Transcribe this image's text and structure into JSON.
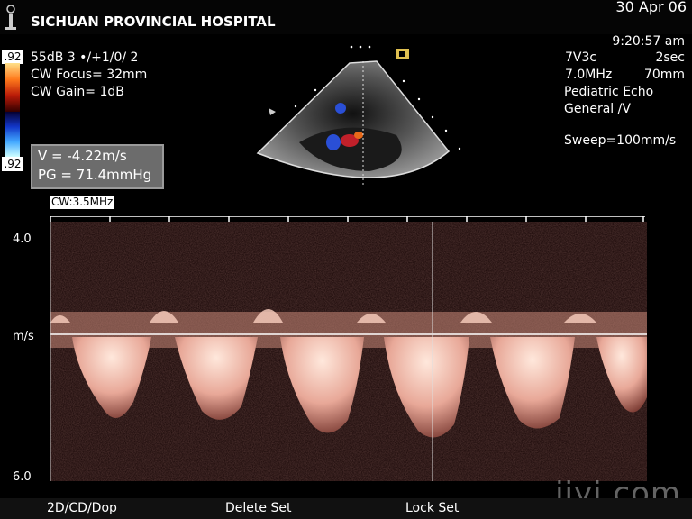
{
  "header": {
    "hospital": "SICHUAN PROVINCIAL HOSPITAL",
    "date": "30 Apr 06"
  },
  "settings_left": {
    "scale_top": ".92",
    "line1": "55dB  3 •/+1/0/ 2",
    "line2": "CW Focus=  32mm",
    "line3": "CW Gain=    1dB",
    "scale_bottom": ".92"
  },
  "measurement": {
    "velocity": "V = -4.22m/s",
    "gradient": "PG = 71.4mmHg"
  },
  "settings_right": {
    "time": "9:20:57 am",
    "probe": "7V3c",
    "interval": "2sec",
    "freq": "7.0MHz",
    "depth": "70mm",
    "preset": "Pediatric Echo",
    "mode": "General /V",
    "sweep": "Sweep=100mm/s"
  },
  "doppler": {
    "cw_label": "CW:3.5MHz",
    "axis_top": "4.0",
    "axis_unit": "m/s",
    "axis_bottom": "6.0"
  },
  "menu": {
    "item1": "2D/CD/Dop",
    "item2": "Delete Set",
    "item3": "Lock Set"
  },
  "watermark": "iiyi.com",
  "colors": {
    "spectrum": "#f0c8b8",
    "measurement_box": "#6c6c6c"
  }
}
